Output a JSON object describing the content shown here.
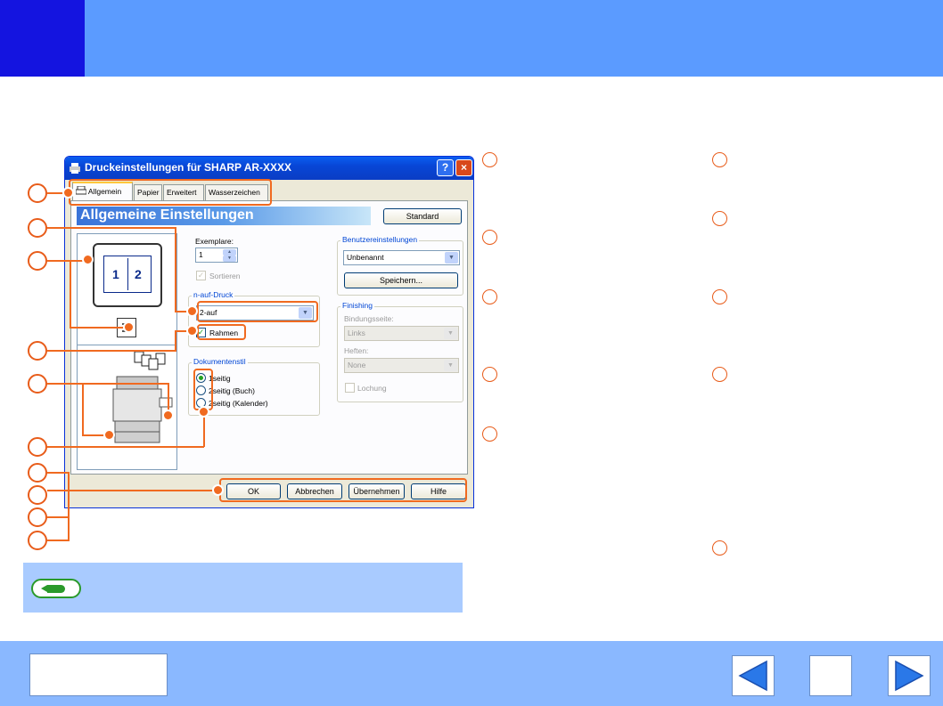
{
  "dialog": {
    "title": "Druckeinstellungen für SHARP AR-XXXX",
    "help_button": "?",
    "close_button": "×",
    "tabs": [
      "Allgemein",
      "Papier",
      "Erweitert",
      "Wasserzeichen"
    ],
    "banner_title": "Allgemeine Einstellungen",
    "standard_button": "Standard",
    "preview": {
      "page_numbers": [
        "1",
        "2"
      ]
    },
    "copies": {
      "label": "Exemplare:",
      "value": "1",
      "collate_label": "Sortieren"
    },
    "nup": {
      "group_title": "n-auf-Druck",
      "selected": "2-auf",
      "border_label": "Rahmen"
    },
    "document_style": {
      "group_title": "Dokumentenstil",
      "options": [
        "1seitig",
        "2seitig (Buch)",
        "2seitig (Kalender)"
      ],
      "selected_index": 0
    },
    "user_settings": {
      "group_title": "Benutzereinstellungen",
      "selected": "Unbenannt",
      "save_button": "Speichern..."
    },
    "finishing": {
      "group_title": "Finishing",
      "binding_label": "Bindungsseite:",
      "binding_value": "Links",
      "staple_label": "Heften:",
      "staple_value": "None",
      "punch_label": "Lochung"
    },
    "footer_buttons": [
      "OK",
      "Abbrechen",
      "Übernehmen",
      "Hilfe"
    ]
  },
  "colors": {
    "header": "#5b9bff",
    "header_accent": "#1414e0",
    "footer": "#8ab8ff",
    "callout": "#f06a20",
    "note": "#a9cbff"
  },
  "icons": {
    "printer": "printer-icon",
    "pencil": "pencil-icon",
    "prev": "left-arrow-icon",
    "next": "right-arrow-icon"
  }
}
